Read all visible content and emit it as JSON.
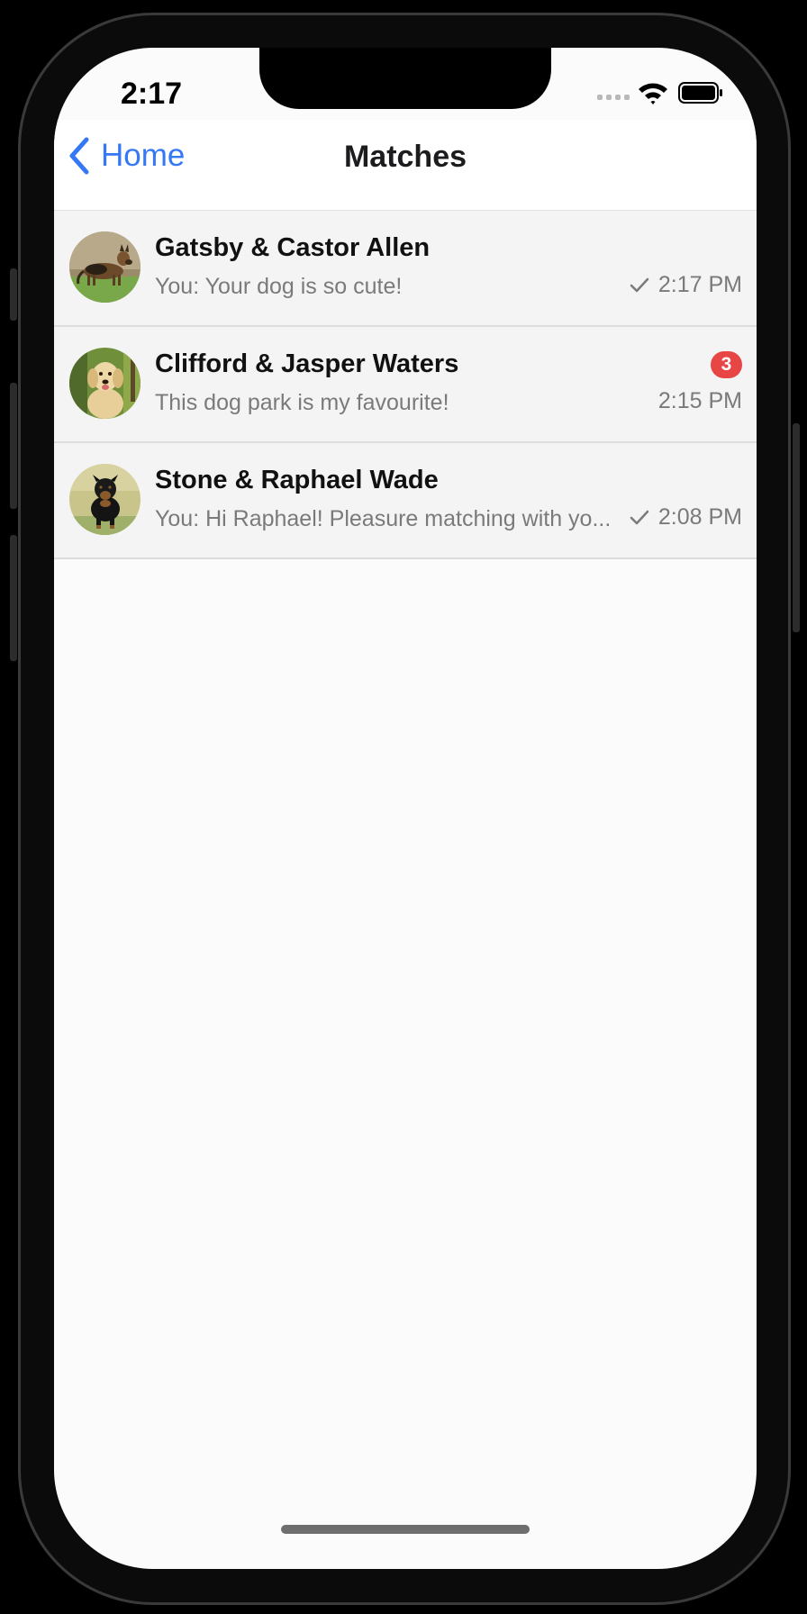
{
  "status_bar": {
    "time": "2:17"
  },
  "nav": {
    "back_label": "Home",
    "title": "Matches"
  },
  "matches": [
    {
      "title": "Gatsby & Castor Allen",
      "preview": "You: Your dog is so cute!",
      "time": "2:17 PM",
      "read_receipt": true,
      "unread_count": null,
      "avatar_icon": "german-shepherd-avatar"
    },
    {
      "title": "Clifford & Jasper Waters",
      "preview": "This dog park is my favourite!",
      "time": "2:15 PM",
      "read_receipt": false,
      "unread_count": "3",
      "avatar_icon": "golden-retriever-avatar"
    },
    {
      "title": "Stone & Raphael Wade",
      "preview": "You: Hi Raphael! Pleasure matching with yo...",
      "time": "2:08 PM",
      "read_receipt": true,
      "unread_count": null,
      "avatar_icon": "rottweiler-avatar"
    }
  ],
  "colors": {
    "accent": "#3478f6",
    "badge": "#e84545",
    "secondary_text": "#7a7a7a",
    "row_background": "#f4f4f4"
  }
}
